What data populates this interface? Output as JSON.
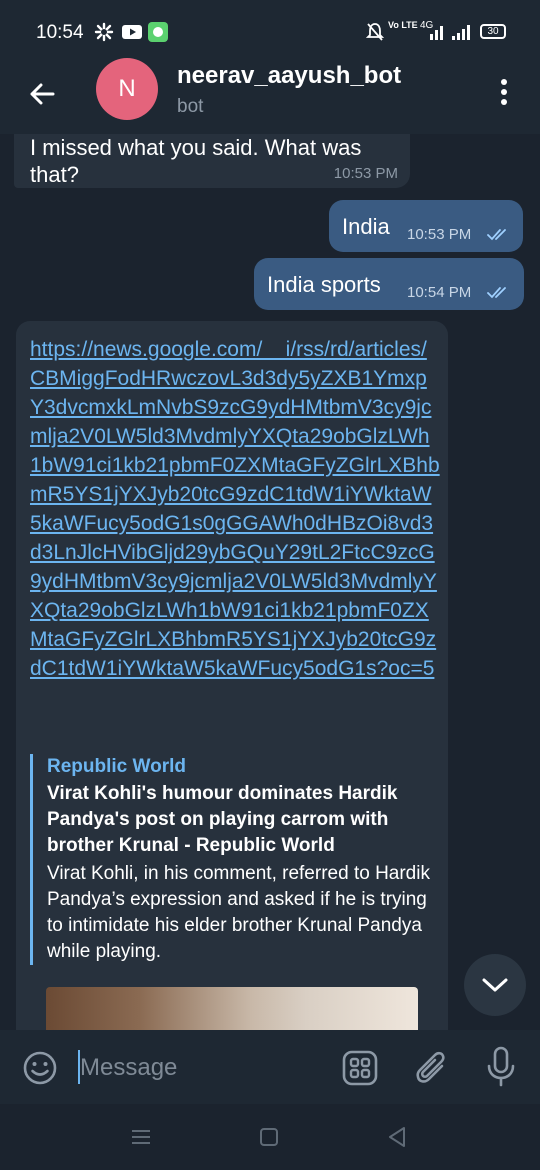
{
  "status_bar": {
    "time": "10:54",
    "network_labels": "Vo LTE",
    "signal_label": "4G",
    "battery": "30"
  },
  "header": {
    "avatar_letter": "N",
    "title": "neerav_aayush_bot",
    "subtitle": "bot"
  },
  "messages": [
    {
      "text": "I missed what you said. What was that?",
      "time": "10:53 PM",
      "direction": "in"
    },
    {
      "text": "India",
      "time": "10:53 PM",
      "direction": "out"
    },
    {
      "text": "India sports",
      "time": "10:54 PM",
      "direction": "out"
    },
    {
      "direction": "in",
      "link": "https://news.google.com/__i/rss/rd/articles/CBMiggFodHRwczovL3d3dy5yZXB1YmxpY3dvcmxkLmNvbS9zcG9ydHMtbmV3cy9jcmlja2V0LW5ld3MvdmlyYXQta29obGlzLWh1bW91ci1kb21pbmF0ZXMtaGFyZGlrLXBhbmR5YS1jYXJyb20tcG9zdC1tdW1iYWktaW5kaWFucy5odG1s0gGGAWh0dHBzOi8vd3d3LnJlcHVibGljd29ybGQuY29tL2FtcC9zcG9ydHMtbmV3cy9jcmlja2V0LW5ld3MvdmlyYXQta29obGlzLWh1bW91ci1kb21pbmF0ZXMtaGFyZGlrLXBhbmR5YS1jYXJyb20tcG9zdC1tdW1iYWktaW5kaWFucy5odG1sP2FtcD1vYz01",
      "link_display": "https://news.google.com/__i/rss/rd/articles/CBMiggFodHRwczovL3d3dy5yZXB1YmxpY3dvcmxkLmNvbS9zcG9ydHMtbmV3cy9jcmlja2V0LW5ld3MvdmlyYXQta29obGlzLWh1bW91ci1kb21pbmF0ZXMtaGFyZGlrLXBhbmR5YS1jYXJyb20tcG9zdC1tdW1iYWktaW5kaWFucy5odG1s0gGGAWh0dHBzOi8vd3d3LnJlcHVibGljd29ybGQuY29tL2FtcC9zcG9ydHMtbmV3cy9jcmlja2V0LW5ld3MvdmlyYXQta29obGlzLWh1bW91ci1kb21pbmF0ZXMtaGFyZGlrLXBhbmR5YS1jYXJyb20tcG9zdC1tdW1iYWktaW5kaWFucy5odG1s?oc=5",
      "preview": {
        "site": "Republic World",
        "title": "Virat Kohli's humour dominates Hardik Pandya's post on playing carrom with brother Krunal - Republic World",
        "description": "Virat Kohli, in his comment, referred to Hardik Pandya’s expression and asked if he is trying to intimidate his elder brother Krunal Pandya while playing."
      }
    }
  ],
  "input": {
    "placeholder": "Message",
    "value": ""
  },
  "colors": {
    "background": "#1b232e",
    "header": "#1e2833",
    "incoming_bubble": "#27313d",
    "outgoing_bubble": "#3a5b82",
    "link": "#6cb5f0",
    "avatar": "#e4647c"
  }
}
